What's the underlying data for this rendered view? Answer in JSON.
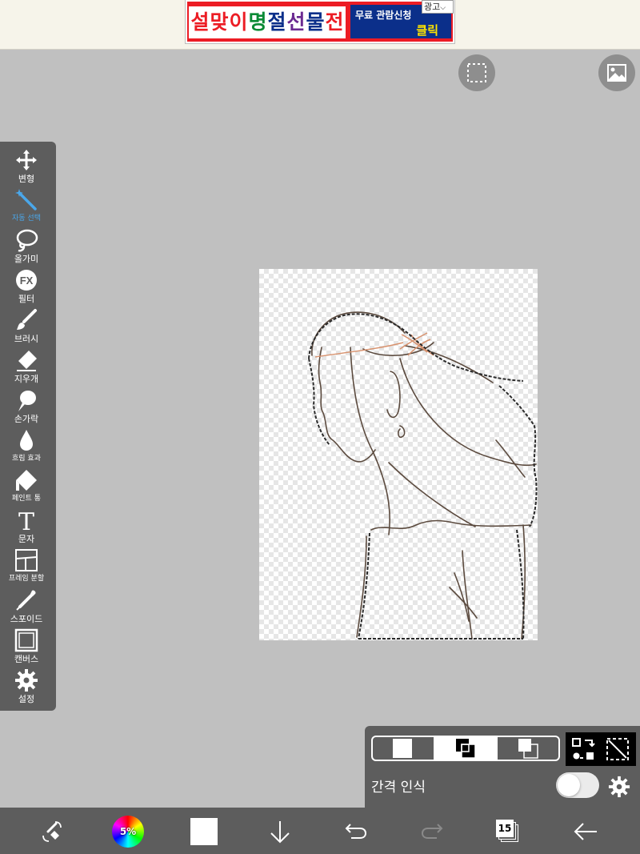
{
  "ad": {
    "main_chars": [
      {
        "ch": "설",
        "color": "#ec1c24"
      },
      {
        "ch": "맞",
        "color": "#ec1c24"
      },
      {
        "ch": "이",
        "color": "#ec1c24"
      },
      {
        "ch": "명",
        "color": "#0a8a35"
      },
      {
        "ch": "절",
        "color": "#0b2f8a"
      },
      {
        "ch": "선",
        "color": "#6b2a91"
      },
      {
        "ch": "물",
        "color": "#0b2f8a"
      },
      {
        "ch": "전",
        "color": "#ec1c24"
      }
    ],
    "cta_line1": "무료 관람신청",
    "cta_line2": "클릭",
    "tag": "광고"
  },
  "top_buttons": {
    "selection_icon": "dashed-square-icon",
    "image_icon": "image-icon"
  },
  "toolbar": {
    "active_color": "#4aa7ea",
    "tools": [
      {
        "id": "transform",
        "icon": "move-arrows-icon",
        "label": "변형",
        "active": false
      },
      {
        "id": "magic-wand",
        "icon": "magic-wand-icon",
        "label": "자동 선택",
        "active": true
      },
      {
        "id": "lasso",
        "icon": "lasso-icon",
        "label": "올가미",
        "active": false
      },
      {
        "id": "filter",
        "icon": "fx-icon",
        "label": "필터",
        "active": false
      },
      {
        "id": "brush",
        "icon": "brush-icon",
        "label": "브러시",
        "active": false
      },
      {
        "id": "eraser",
        "icon": "eraser-icon",
        "label": "지우개",
        "active": false
      },
      {
        "id": "finger",
        "icon": "smudge-icon",
        "label": "손가락",
        "active": false
      },
      {
        "id": "blur",
        "icon": "droplet-icon",
        "label": "흐림 효과",
        "active": false
      },
      {
        "id": "bucket",
        "icon": "paint-bucket-icon",
        "label": "페인트 통",
        "active": false
      },
      {
        "id": "text",
        "icon": "text-icon",
        "label": "문자",
        "active": false
      },
      {
        "id": "frame",
        "icon": "frame-divider-icon",
        "label": "프레임 분할",
        "active": false
      },
      {
        "id": "eyedropper",
        "icon": "eyedropper-icon",
        "label": "스포이드",
        "active": false
      },
      {
        "id": "canvas",
        "icon": "canvas-icon",
        "label": "캔버스",
        "active": false
      },
      {
        "id": "settings",
        "icon": "gear-icon",
        "label": "설정",
        "active": false
      }
    ]
  },
  "selection_panel": {
    "selected_mode": 2,
    "gap_label": "간격 인식",
    "gap_enabled": false
  },
  "bottom_bar": {
    "color_wheel_label": "5%",
    "layer_count": "15",
    "current_color": "#ffffff"
  }
}
